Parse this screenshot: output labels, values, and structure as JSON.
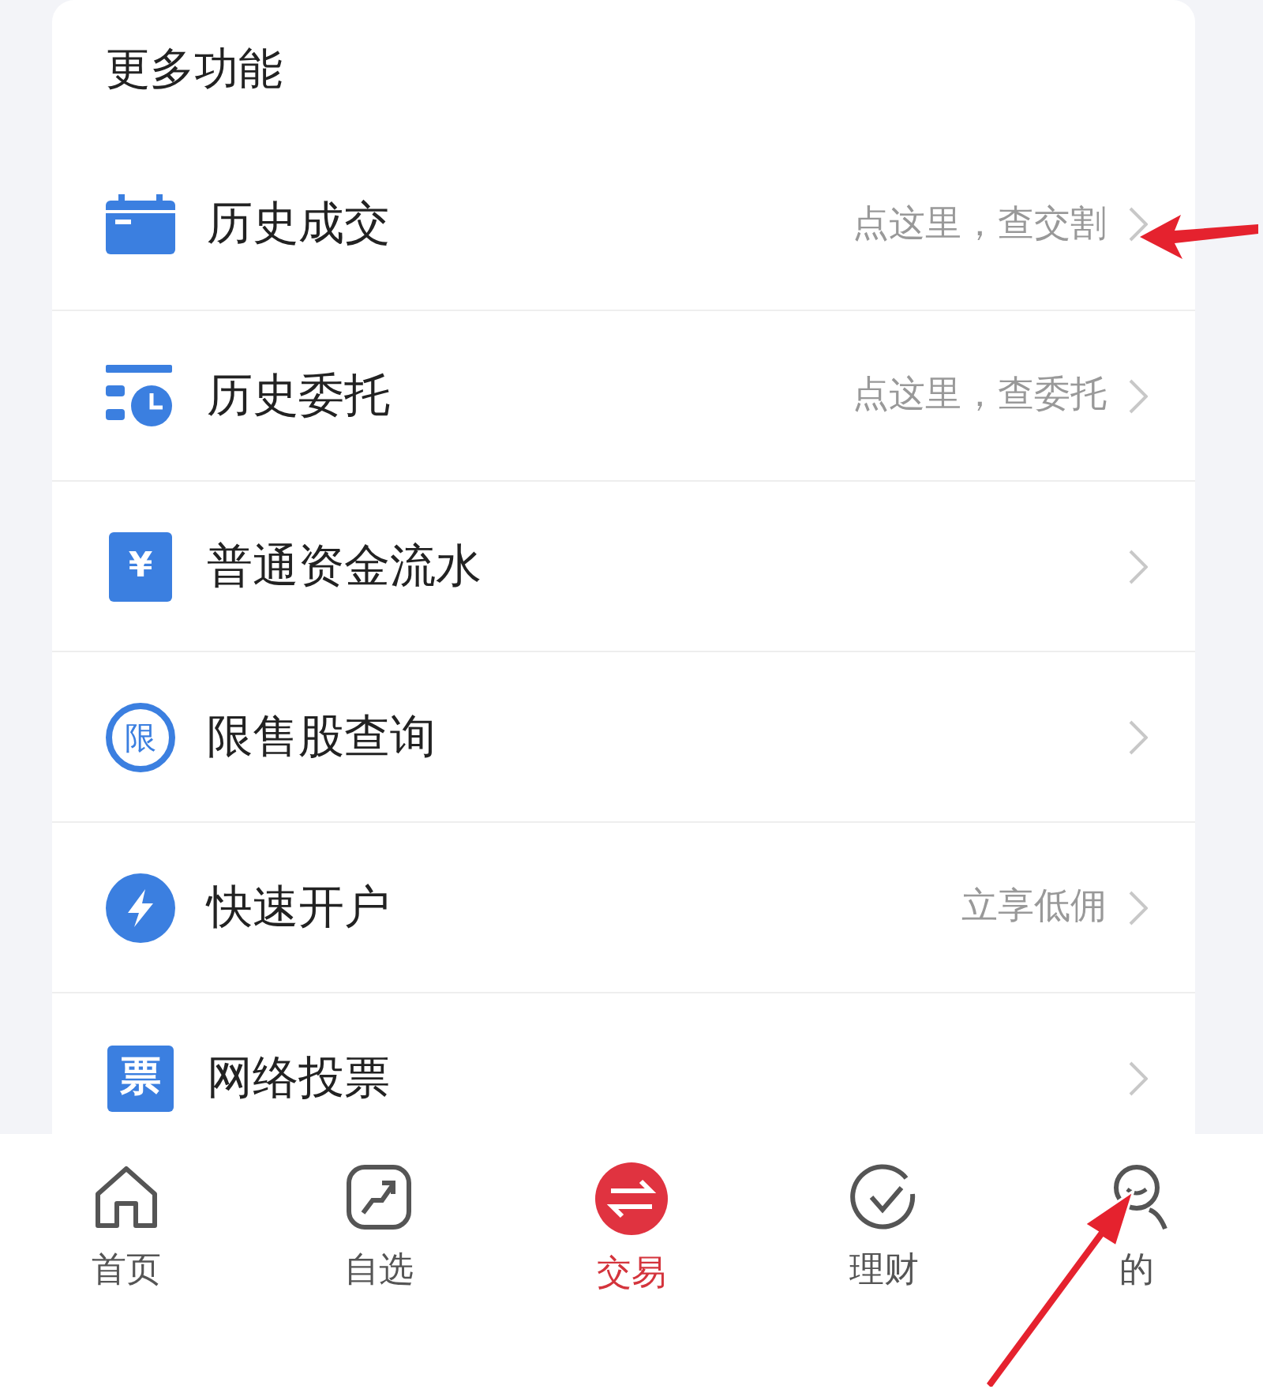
{
  "section": {
    "title": "更多功能",
    "items": [
      {
        "label": "历史成交",
        "hint": "点这里，查交割"
      },
      {
        "label": "历史委托",
        "hint": "点这里，查委托"
      },
      {
        "label": "普通资金流水",
        "icon_glyph": "¥"
      },
      {
        "label": "限售股查询",
        "icon_glyph": "限"
      },
      {
        "label": "快速开户",
        "hint": "立享低佣"
      },
      {
        "label": "网络投票",
        "icon_glyph": "票"
      }
    ]
  },
  "tab_bar": [
    {
      "label": "首页",
      "selected": false
    },
    {
      "label": "自选",
      "selected": false
    },
    {
      "label": "交易",
      "selected": true
    },
    {
      "label": "理财",
      "selected": false
    },
    {
      "label": "的",
      "selected": false
    }
  ]
}
